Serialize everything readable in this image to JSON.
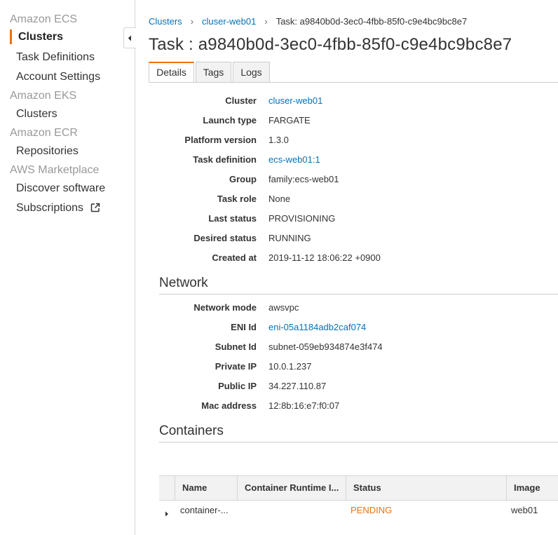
{
  "sidebar": {
    "groups": [
      {
        "title": "Amazon ECS",
        "items": [
          "Clusters",
          "Task Definitions",
          "Account Settings"
        ]
      },
      {
        "title": "Amazon EKS",
        "items": [
          "Clusters"
        ]
      },
      {
        "title": "Amazon ECR",
        "items": [
          "Repositories"
        ]
      },
      {
        "title": "AWS Marketplace",
        "items": [
          "Discover software",
          "Subscriptions"
        ]
      }
    ],
    "active_item": "Clusters"
  },
  "breadcrumb": {
    "items": [
      "Clusters",
      "cluser-web01"
    ],
    "current": "Task: a9840b0d-3ec0-4fbb-85f0-c9e4bc9bc8e7"
  },
  "page_title": "Task : a9840b0d-3ec0-4fbb-85f0-c9e4bc9bc8e7",
  "tabs": [
    "Details",
    "Tags",
    "Logs"
  ],
  "active_tab": "Details",
  "details": [
    {
      "label": "Cluster",
      "value": "cluser-web01",
      "link": true
    },
    {
      "label": "Launch type",
      "value": "FARGATE"
    },
    {
      "label": "Platform version",
      "value": "1.3.0"
    },
    {
      "label": "Task definition",
      "value": "ecs-web01:1",
      "link": true
    },
    {
      "label": "Group",
      "value": "family:ecs-web01"
    },
    {
      "label": "Task role",
      "value": "None"
    },
    {
      "label": "Last status",
      "value": "PROVISIONING"
    },
    {
      "label": "Desired status",
      "value": "RUNNING"
    },
    {
      "label": "Created at",
      "value": "2019-11-12 18:06:22 +0900"
    }
  ],
  "network": {
    "title": "Network",
    "rows": [
      {
        "label": "Network mode",
        "value": "awsvpc"
      },
      {
        "label": "ENI Id",
        "value": "eni-05a1184adb2caf074",
        "link": true
      },
      {
        "label": "Subnet Id",
        "value": "subnet-059eb934874e3f474"
      },
      {
        "label": "Private IP",
        "value": "10.0.1.237"
      },
      {
        "label": "Public IP",
        "value": "34.227.110.87"
      },
      {
        "label": "Mac address",
        "value": "12:8b:16:e7:f0:07"
      }
    ]
  },
  "containers": {
    "title": "Containers",
    "columns": [
      "Name",
      "Container Runtime I...",
      "Status",
      "Image"
    ],
    "rows": [
      {
        "name": "container-...",
        "runtime_id": "",
        "status": "PENDING",
        "image": "web01"
      }
    ]
  },
  "colors": {
    "accent": "#ec7211",
    "link": "#0073bb"
  }
}
